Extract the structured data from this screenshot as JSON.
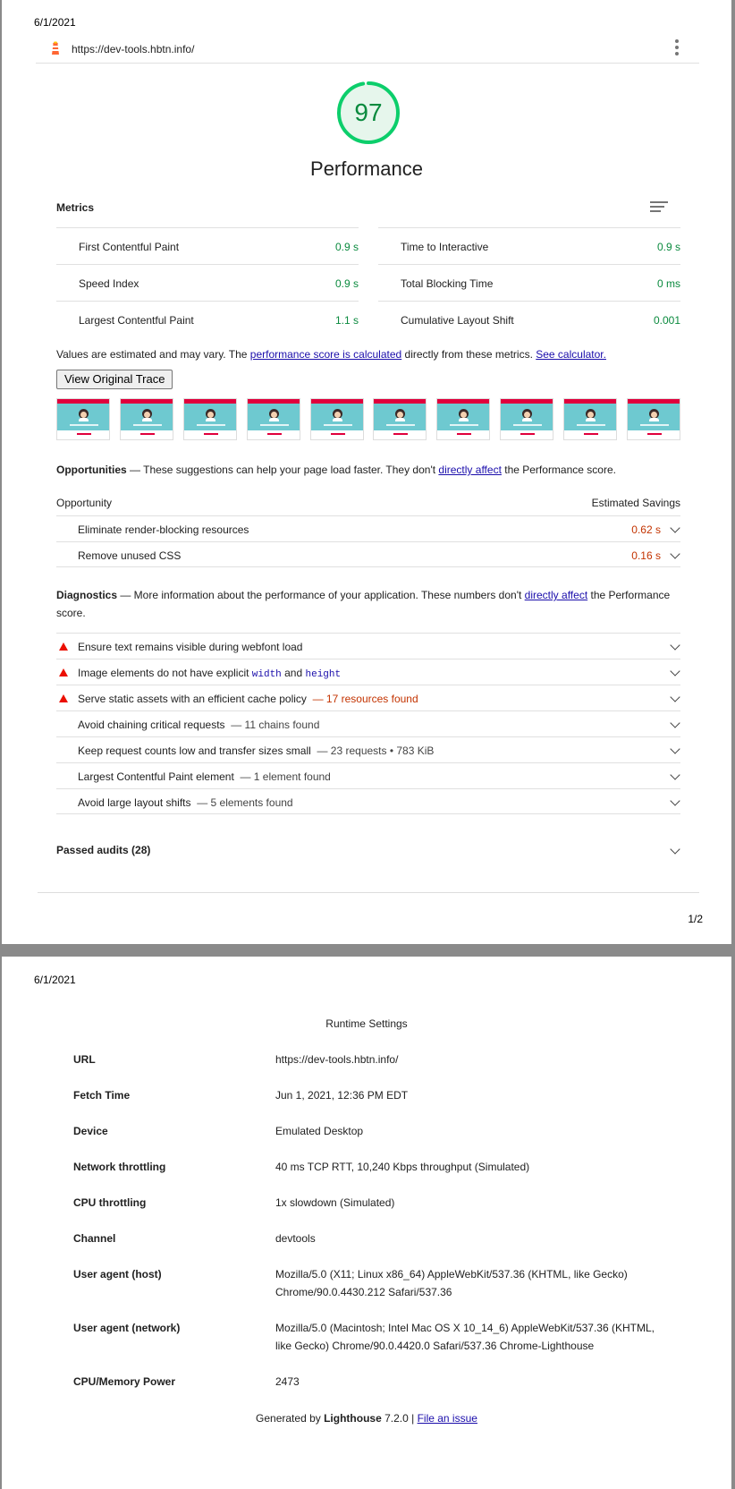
{
  "page1": {
    "date": "6/1/2021",
    "url": "https://dev-tools.hbtn.info/",
    "score": "97",
    "category_title": "Performance",
    "metrics_heading": "Metrics",
    "metrics_left": [
      {
        "label": "First Contentful Paint",
        "value": "0.9 s"
      },
      {
        "label": "Speed Index",
        "value": "0.9 s"
      },
      {
        "label": "Largest Contentful Paint",
        "value": "1.1 s"
      }
    ],
    "metrics_right": [
      {
        "label": "Time to Interactive",
        "value": "0.9 s"
      },
      {
        "label": "Total Blocking Time",
        "value": "0 ms"
      },
      {
        "label": "Cumulative Layout Shift",
        "value": "0.001"
      }
    ],
    "note_pre": "Values are estimated and may vary. The ",
    "note_link1": "performance score is calculated",
    "note_mid": " directly from these metrics. ",
    "note_link2": "See calculator.",
    "view_trace_label": "View Original Trace",
    "opportunities": {
      "title": "Opportunities",
      "desc_pre": " — These suggestions can help your page load faster. They don't ",
      "desc_link": "directly affect",
      "desc_post": " the Performance score.",
      "col_left": "Opportunity",
      "col_right": "Estimated Savings",
      "items": [
        {
          "title": "Eliminate render-blocking resources",
          "savings": "0.62 s"
        },
        {
          "title": "Remove unused CSS",
          "savings": "0.16 s"
        }
      ]
    },
    "diagnostics": {
      "title": "Diagnostics",
      "desc_pre": " — More information about the performance of your application. These numbers don't ",
      "desc_link": "directly affect",
      "desc_post": " the Performance score.",
      "item1": "Ensure text remains visible during webfont load",
      "item2_pre": "Image elements do not have explicit ",
      "item2_code1": "width",
      "item2_mid": " and ",
      "item2_code2": "height",
      "item3": "Serve static assets with an efficient cache policy",
      "item3_detail": "— 17 resources found",
      "item4": "Avoid chaining critical requests",
      "item4_detail": "— 11 chains found",
      "item5": "Keep request counts low and transfer sizes small",
      "item5_detail": "— 23 requests • 783 KiB",
      "item6": "Largest Contentful Paint element",
      "item6_detail": "— 1 element found",
      "item7": "Avoid large layout shifts",
      "item7_detail": "— 5 elements found"
    },
    "passed_audits": "Passed audits (28)",
    "page_number": "1/2"
  },
  "page2": {
    "date": "6/1/2021",
    "title": "Runtime Settings",
    "rows": [
      {
        "key": "URL",
        "value": "https://dev-tools.hbtn.info/"
      },
      {
        "key": "Fetch Time",
        "value": "Jun 1, 2021, 12:36 PM EDT"
      },
      {
        "key": "Device",
        "value": "Emulated Desktop"
      },
      {
        "key": "Network throttling",
        "value": "40 ms TCP RTT, 10,240 Kbps throughput (Simulated)"
      },
      {
        "key": "CPU throttling",
        "value": "1x slowdown (Simulated)"
      },
      {
        "key": "Channel",
        "value": "devtools"
      },
      {
        "key": "User agent (host)",
        "value": "Mozilla/5.0 (X11; Linux x86_64) AppleWebKit/537.36 (KHTML, like Gecko) Chrome/90.0.4430.212 Safari/537.36"
      },
      {
        "key": "User agent (network)",
        "value": "Mozilla/5.0 (Macintosh; Intel Mac OS X 10_14_6) AppleWebKit/537.36 (KHTML, like Gecko) Chrome/90.0.4420.0 Safari/537.36 Chrome-Lighthouse"
      },
      {
        "key": "CPU/Memory Power",
        "value": "2473"
      }
    ],
    "generated_pre": "Generated by ",
    "generated_brand": "Lighthouse",
    "generated_version": " 7.2.0 | ",
    "file_issue": "File an issue"
  },
  "colors": {
    "pass": "#0a8a3e",
    "average": "#c33300",
    "fail": "#eb0f00",
    "link": "#1a0dab"
  },
  "gauge_fraction": 0.97
}
